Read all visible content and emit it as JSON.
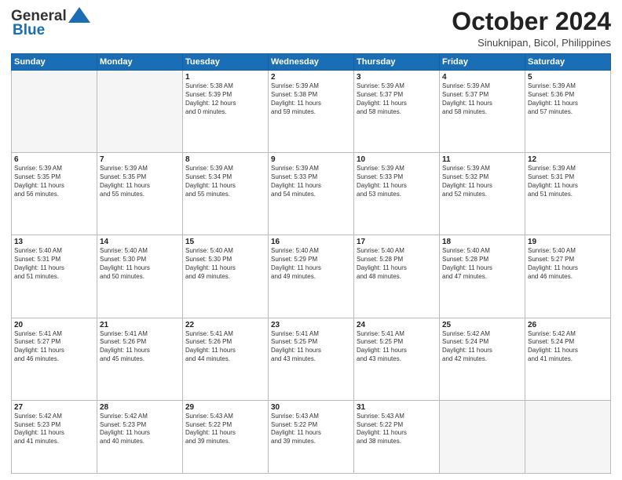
{
  "logo": {
    "line1": "General",
    "line2": "Blue"
  },
  "title": "October 2024",
  "location": "Sinuknipan, Bicol, Philippines",
  "headers": [
    "Sunday",
    "Monday",
    "Tuesday",
    "Wednesday",
    "Thursday",
    "Friday",
    "Saturday"
  ],
  "weeks": [
    [
      {
        "day": "",
        "info": ""
      },
      {
        "day": "",
        "info": ""
      },
      {
        "day": "1",
        "info": "Sunrise: 5:38 AM\nSunset: 5:39 PM\nDaylight: 12 hours\nand 0 minutes."
      },
      {
        "day": "2",
        "info": "Sunrise: 5:39 AM\nSunset: 5:38 PM\nDaylight: 11 hours\nand 59 minutes."
      },
      {
        "day": "3",
        "info": "Sunrise: 5:39 AM\nSunset: 5:37 PM\nDaylight: 11 hours\nand 58 minutes."
      },
      {
        "day": "4",
        "info": "Sunrise: 5:39 AM\nSunset: 5:37 PM\nDaylight: 11 hours\nand 58 minutes."
      },
      {
        "day": "5",
        "info": "Sunrise: 5:39 AM\nSunset: 5:36 PM\nDaylight: 11 hours\nand 57 minutes."
      }
    ],
    [
      {
        "day": "6",
        "info": "Sunrise: 5:39 AM\nSunset: 5:35 PM\nDaylight: 11 hours\nand 56 minutes."
      },
      {
        "day": "7",
        "info": "Sunrise: 5:39 AM\nSunset: 5:35 PM\nDaylight: 11 hours\nand 55 minutes."
      },
      {
        "day": "8",
        "info": "Sunrise: 5:39 AM\nSunset: 5:34 PM\nDaylight: 11 hours\nand 55 minutes."
      },
      {
        "day": "9",
        "info": "Sunrise: 5:39 AM\nSunset: 5:33 PM\nDaylight: 11 hours\nand 54 minutes."
      },
      {
        "day": "10",
        "info": "Sunrise: 5:39 AM\nSunset: 5:33 PM\nDaylight: 11 hours\nand 53 minutes."
      },
      {
        "day": "11",
        "info": "Sunrise: 5:39 AM\nSunset: 5:32 PM\nDaylight: 11 hours\nand 52 minutes."
      },
      {
        "day": "12",
        "info": "Sunrise: 5:39 AM\nSunset: 5:31 PM\nDaylight: 11 hours\nand 51 minutes."
      }
    ],
    [
      {
        "day": "13",
        "info": "Sunrise: 5:40 AM\nSunset: 5:31 PM\nDaylight: 11 hours\nand 51 minutes."
      },
      {
        "day": "14",
        "info": "Sunrise: 5:40 AM\nSunset: 5:30 PM\nDaylight: 11 hours\nand 50 minutes."
      },
      {
        "day": "15",
        "info": "Sunrise: 5:40 AM\nSunset: 5:30 PM\nDaylight: 11 hours\nand 49 minutes."
      },
      {
        "day": "16",
        "info": "Sunrise: 5:40 AM\nSunset: 5:29 PM\nDaylight: 11 hours\nand 49 minutes."
      },
      {
        "day": "17",
        "info": "Sunrise: 5:40 AM\nSunset: 5:28 PM\nDaylight: 11 hours\nand 48 minutes."
      },
      {
        "day": "18",
        "info": "Sunrise: 5:40 AM\nSunset: 5:28 PM\nDaylight: 11 hours\nand 47 minutes."
      },
      {
        "day": "19",
        "info": "Sunrise: 5:40 AM\nSunset: 5:27 PM\nDaylight: 11 hours\nand 46 minutes."
      }
    ],
    [
      {
        "day": "20",
        "info": "Sunrise: 5:41 AM\nSunset: 5:27 PM\nDaylight: 11 hours\nand 46 minutes."
      },
      {
        "day": "21",
        "info": "Sunrise: 5:41 AM\nSunset: 5:26 PM\nDaylight: 11 hours\nand 45 minutes."
      },
      {
        "day": "22",
        "info": "Sunrise: 5:41 AM\nSunset: 5:26 PM\nDaylight: 11 hours\nand 44 minutes."
      },
      {
        "day": "23",
        "info": "Sunrise: 5:41 AM\nSunset: 5:25 PM\nDaylight: 11 hours\nand 43 minutes."
      },
      {
        "day": "24",
        "info": "Sunrise: 5:41 AM\nSunset: 5:25 PM\nDaylight: 11 hours\nand 43 minutes."
      },
      {
        "day": "25",
        "info": "Sunrise: 5:42 AM\nSunset: 5:24 PM\nDaylight: 11 hours\nand 42 minutes."
      },
      {
        "day": "26",
        "info": "Sunrise: 5:42 AM\nSunset: 5:24 PM\nDaylight: 11 hours\nand 41 minutes."
      }
    ],
    [
      {
        "day": "27",
        "info": "Sunrise: 5:42 AM\nSunset: 5:23 PM\nDaylight: 11 hours\nand 41 minutes."
      },
      {
        "day": "28",
        "info": "Sunrise: 5:42 AM\nSunset: 5:23 PM\nDaylight: 11 hours\nand 40 minutes."
      },
      {
        "day": "29",
        "info": "Sunrise: 5:43 AM\nSunset: 5:22 PM\nDaylight: 11 hours\nand 39 minutes."
      },
      {
        "day": "30",
        "info": "Sunrise: 5:43 AM\nSunset: 5:22 PM\nDaylight: 11 hours\nand 39 minutes."
      },
      {
        "day": "31",
        "info": "Sunrise: 5:43 AM\nSunset: 5:22 PM\nDaylight: 11 hours\nand 38 minutes."
      },
      {
        "day": "",
        "info": ""
      },
      {
        "day": "",
        "info": ""
      }
    ]
  ]
}
